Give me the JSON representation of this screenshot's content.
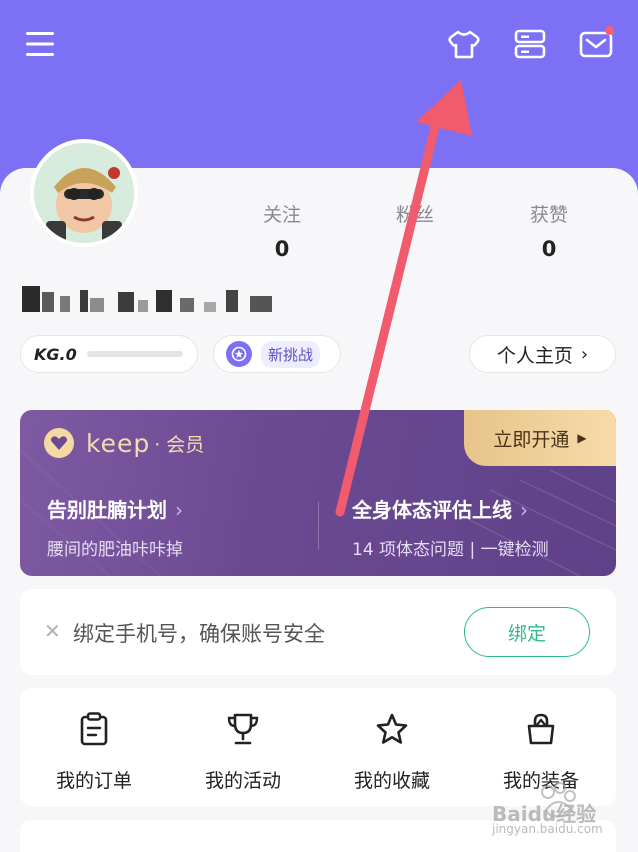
{
  "header": {
    "icons": [
      "menu-icon",
      "shirt-icon",
      "server-icon",
      "mail-icon"
    ],
    "background": "#7c71f5"
  },
  "profile": {
    "stats": [
      {
        "label": "关注",
        "value": "0"
      },
      {
        "label": "粉丝",
        "value": ""
      },
      {
        "label": "获赞",
        "value": "0"
      }
    ]
  },
  "pills": {
    "kg_level": "KG.0",
    "challenge": "新挑战",
    "home": "个人主页",
    "home_arrow": "›"
  },
  "membership": {
    "logo_text": "keep",
    "logo_suffix": "· 会员",
    "open_button": "立即开通",
    "items": [
      {
        "title": "告别肚腩计划",
        "subtitle": "腰间的肥油咔咔掉"
      },
      {
        "title": "全身体态评估上线",
        "subtitle": "14 项体态问题 | 一键检测"
      }
    ]
  },
  "bind_phone": {
    "text": "绑定手机号，确保账号安全",
    "button": "绑定",
    "accent": "#2fba8e"
  },
  "quick_links": [
    {
      "icon": "clipboard-icon",
      "label": "我的订单"
    },
    {
      "icon": "trophy-icon",
      "label": "我的活动"
    },
    {
      "icon": "star-icon",
      "label": "我的收藏"
    },
    {
      "icon": "bag-icon",
      "label": "我的装备"
    }
  ],
  "watermark": {
    "brand": "Baidu经验",
    "url": "jingyan.baidu.com"
  }
}
